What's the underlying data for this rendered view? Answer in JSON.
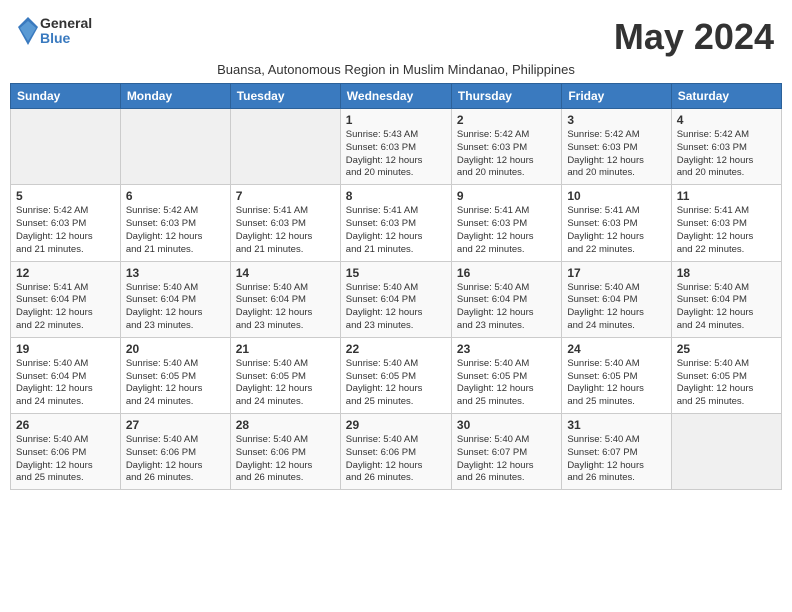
{
  "logo": {
    "general": "General",
    "blue": "Blue"
  },
  "title": "May 2024",
  "subtitle": "Buansa, Autonomous Region in Muslim Mindanao, Philippines",
  "days_of_week": [
    "Sunday",
    "Monday",
    "Tuesday",
    "Wednesday",
    "Thursday",
    "Friday",
    "Saturday"
  ],
  "weeks": [
    [
      {
        "day": "",
        "info": ""
      },
      {
        "day": "",
        "info": ""
      },
      {
        "day": "",
        "info": ""
      },
      {
        "day": "1",
        "info": "Sunrise: 5:43 AM\nSunset: 6:03 PM\nDaylight: 12 hours\nand 20 minutes."
      },
      {
        "day": "2",
        "info": "Sunrise: 5:42 AM\nSunset: 6:03 PM\nDaylight: 12 hours\nand 20 minutes."
      },
      {
        "day": "3",
        "info": "Sunrise: 5:42 AM\nSunset: 6:03 PM\nDaylight: 12 hours\nand 20 minutes."
      },
      {
        "day": "4",
        "info": "Sunrise: 5:42 AM\nSunset: 6:03 PM\nDaylight: 12 hours\nand 20 minutes."
      }
    ],
    [
      {
        "day": "5",
        "info": "Sunrise: 5:42 AM\nSunset: 6:03 PM\nDaylight: 12 hours\nand 21 minutes."
      },
      {
        "day": "6",
        "info": "Sunrise: 5:42 AM\nSunset: 6:03 PM\nDaylight: 12 hours\nand 21 minutes."
      },
      {
        "day": "7",
        "info": "Sunrise: 5:41 AM\nSunset: 6:03 PM\nDaylight: 12 hours\nand 21 minutes."
      },
      {
        "day": "8",
        "info": "Sunrise: 5:41 AM\nSunset: 6:03 PM\nDaylight: 12 hours\nand 21 minutes."
      },
      {
        "day": "9",
        "info": "Sunrise: 5:41 AM\nSunset: 6:03 PM\nDaylight: 12 hours\nand 22 minutes."
      },
      {
        "day": "10",
        "info": "Sunrise: 5:41 AM\nSunset: 6:03 PM\nDaylight: 12 hours\nand 22 minutes."
      },
      {
        "day": "11",
        "info": "Sunrise: 5:41 AM\nSunset: 6:03 PM\nDaylight: 12 hours\nand 22 minutes."
      }
    ],
    [
      {
        "day": "12",
        "info": "Sunrise: 5:41 AM\nSunset: 6:04 PM\nDaylight: 12 hours\nand 22 minutes."
      },
      {
        "day": "13",
        "info": "Sunrise: 5:40 AM\nSunset: 6:04 PM\nDaylight: 12 hours\nand 23 minutes."
      },
      {
        "day": "14",
        "info": "Sunrise: 5:40 AM\nSunset: 6:04 PM\nDaylight: 12 hours\nand 23 minutes."
      },
      {
        "day": "15",
        "info": "Sunrise: 5:40 AM\nSunset: 6:04 PM\nDaylight: 12 hours\nand 23 minutes."
      },
      {
        "day": "16",
        "info": "Sunrise: 5:40 AM\nSunset: 6:04 PM\nDaylight: 12 hours\nand 23 minutes."
      },
      {
        "day": "17",
        "info": "Sunrise: 5:40 AM\nSunset: 6:04 PM\nDaylight: 12 hours\nand 24 minutes."
      },
      {
        "day": "18",
        "info": "Sunrise: 5:40 AM\nSunset: 6:04 PM\nDaylight: 12 hours\nand 24 minutes."
      }
    ],
    [
      {
        "day": "19",
        "info": "Sunrise: 5:40 AM\nSunset: 6:04 PM\nDaylight: 12 hours\nand 24 minutes."
      },
      {
        "day": "20",
        "info": "Sunrise: 5:40 AM\nSunset: 6:05 PM\nDaylight: 12 hours\nand 24 minutes."
      },
      {
        "day": "21",
        "info": "Sunrise: 5:40 AM\nSunset: 6:05 PM\nDaylight: 12 hours\nand 24 minutes."
      },
      {
        "day": "22",
        "info": "Sunrise: 5:40 AM\nSunset: 6:05 PM\nDaylight: 12 hours\nand 25 minutes."
      },
      {
        "day": "23",
        "info": "Sunrise: 5:40 AM\nSunset: 6:05 PM\nDaylight: 12 hours\nand 25 minutes."
      },
      {
        "day": "24",
        "info": "Sunrise: 5:40 AM\nSunset: 6:05 PM\nDaylight: 12 hours\nand 25 minutes."
      },
      {
        "day": "25",
        "info": "Sunrise: 5:40 AM\nSunset: 6:05 PM\nDaylight: 12 hours\nand 25 minutes."
      }
    ],
    [
      {
        "day": "26",
        "info": "Sunrise: 5:40 AM\nSunset: 6:06 PM\nDaylight: 12 hours\nand 25 minutes."
      },
      {
        "day": "27",
        "info": "Sunrise: 5:40 AM\nSunset: 6:06 PM\nDaylight: 12 hours\nand 26 minutes."
      },
      {
        "day": "28",
        "info": "Sunrise: 5:40 AM\nSunset: 6:06 PM\nDaylight: 12 hours\nand 26 minutes."
      },
      {
        "day": "29",
        "info": "Sunrise: 5:40 AM\nSunset: 6:06 PM\nDaylight: 12 hours\nand 26 minutes."
      },
      {
        "day": "30",
        "info": "Sunrise: 5:40 AM\nSunset: 6:07 PM\nDaylight: 12 hours\nand 26 minutes."
      },
      {
        "day": "31",
        "info": "Sunrise: 5:40 AM\nSunset: 6:07 PM\nDaylight: 12 hours\nand 26 minutes."
      },
      {
        "day": "",
        "info": ""
      }
    ]
  ]
}
